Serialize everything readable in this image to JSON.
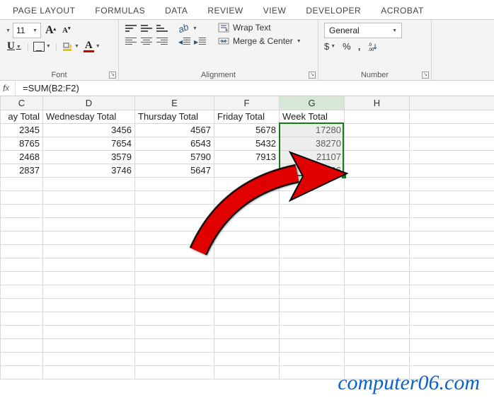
{
  "tabs": [
    "PAGE LAYOUT",
    "FORMULAS",
    "DATA",
    "REVIEW",
    "VIEW",
    "DEVELOPER",
    "ACROBAT"
  ],
  "font": {
    "size": "11",
    "groupLabel": "Font"
  },
  "align": {
    "wrap": "Wrap Text",
    "merge": "Merge & Center",
    "groupLabel": "Alignment"
  },
  "number": {
    "format": "General",
    "groupLabel": "Number"
  },
  "formula": "=SUM(B2:F2)",
  "cols": [
    "C",
    "D",
    "E",
    "F",
    "G",
    "H"
  ],
  "headers": {
    "c": "ay Total",
    "d": "Wednesday Total",
    "e": "Thursday Total",
    "f": "Friday Total",
    "g": "Week Total"
  },
  "rows": [
    {
      "c": "2345",
      "d": "3456",
      "e": "4567",
      "f": "5678",
      "g": "17280"
    },
    {
      "c": "8765",
      "d": "7654",
      "e": "6543",
      "f": "5432",
      "g": "38270"
    },
    {
      "c": "2468",
      "d": "3579",
      "e": "5790",
      "f": "7913",
      "g": "21107"
    },
    {
      "c": "2837",
      "d": "3746",
      "e": "5647",
      "f": "",
      "g": "18896"
    }
  ],
  "watermark": "computer06.com"
}
